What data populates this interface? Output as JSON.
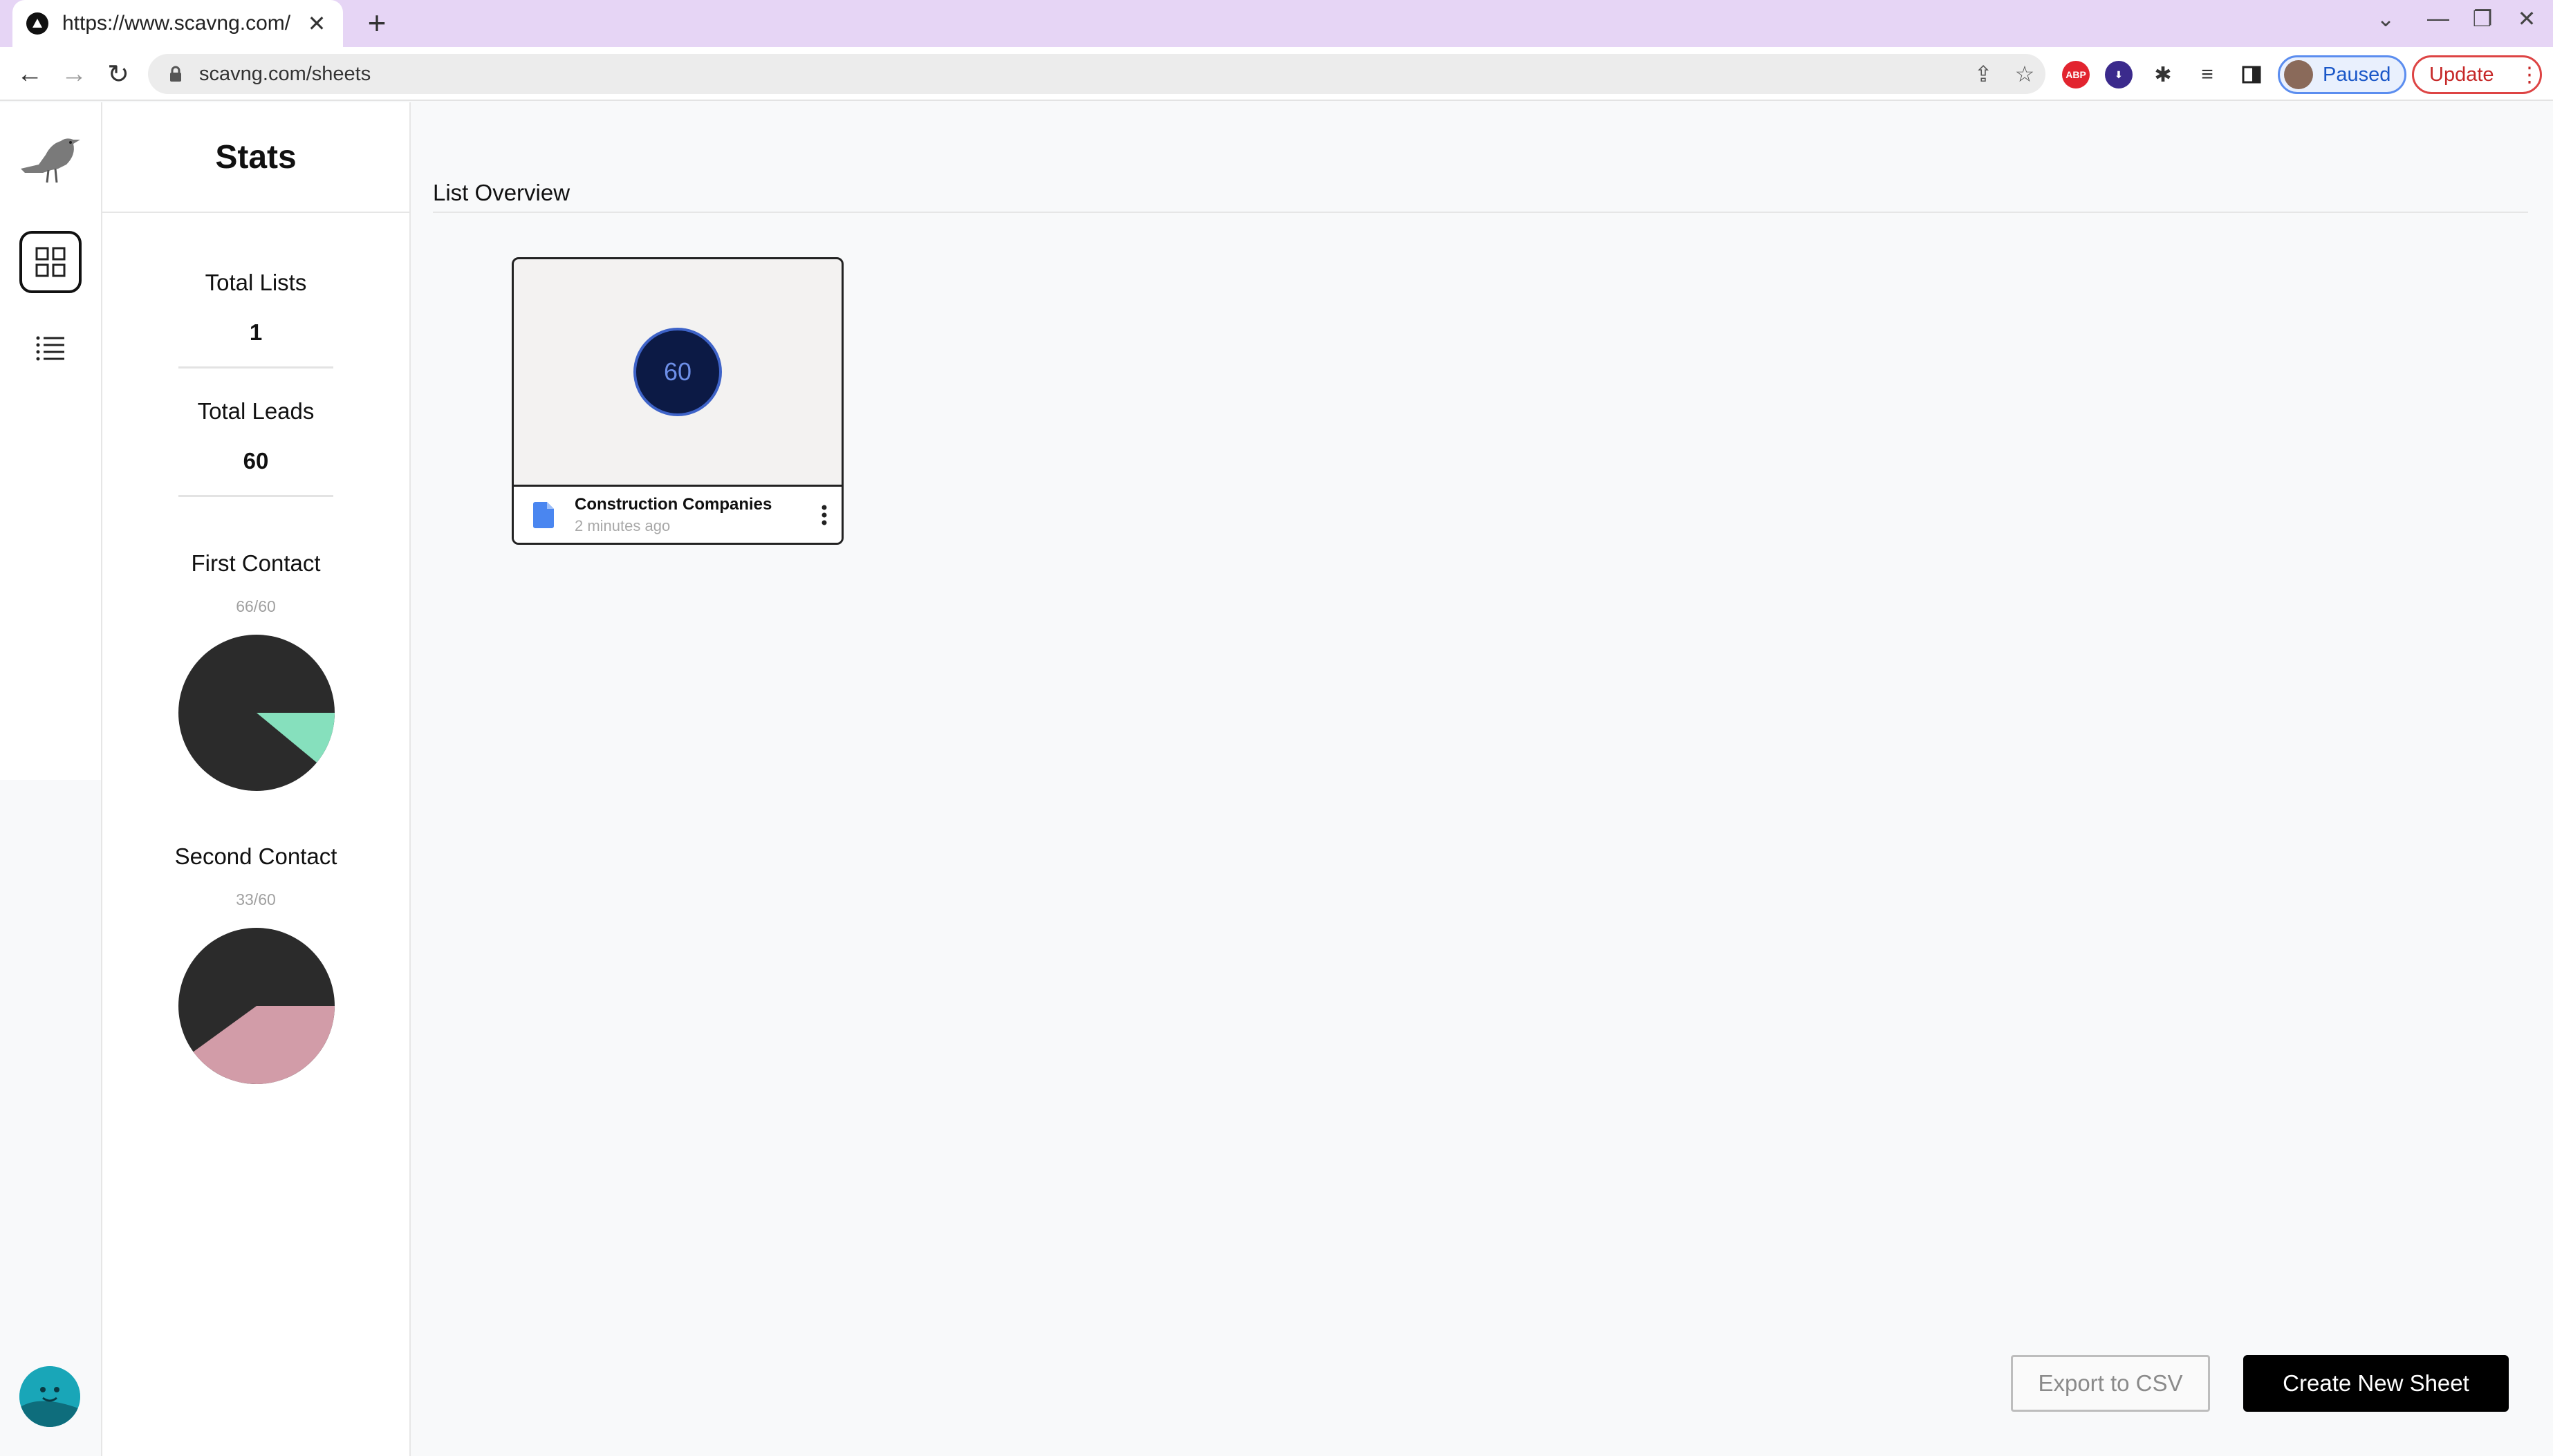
{
  "browser": {
    "tab_title": "https://www.scavng.com/",
    "tab_close": "✕",
    "new_tab": "+",
    "url": "scavng.com/sheets",
    "profile_status": "Paused",
    "update_label": "Update"
  },
  "icons": {
    "back": "←",
    "forward": "→",
    "reload": "↻",
    "share": "⇪",
    "star": "☆",
    "chevron": "⌄",
    "minimize": "—",
    "restore": "❐",
    "close": "✕",
    "menu": "⋮"
  },
  "stats": {
    "title": "Stats",
    "total_lists_label": "Total Lists",
    "total_lists_value": "1",
    "total_leads_label": "Total Leads",
    "total_leads_value": "60",
    "first_contact_label": "First Contact",
    "first_contact_ratio": "66/60",
    "first_contact_fraction": 0.11,
    "first_contact_color": "#86e0bd",
    "second_contact_label": "Second Contact",
    "second_contact_ratio": "33/60",
    "second_contact_fraction": 0.4,
    "second_contact_color": "#d29ca8",
    "pie_base_color": "#2b2b2b"
  },
  "main": {
    "title": "List Overview",
    "cards": [
      {
        "count": "60",
        "name": "Construction Companies",
        "time": "2 minutes ago"
      }
    ],
    "export_label": "Export to CSV",
    "create_label": "Create New Sheet"
  },
  "colors": {
    "accent_blue": "#3e63c8",
    "doc_blue": "#4a86f0"
  }
}
